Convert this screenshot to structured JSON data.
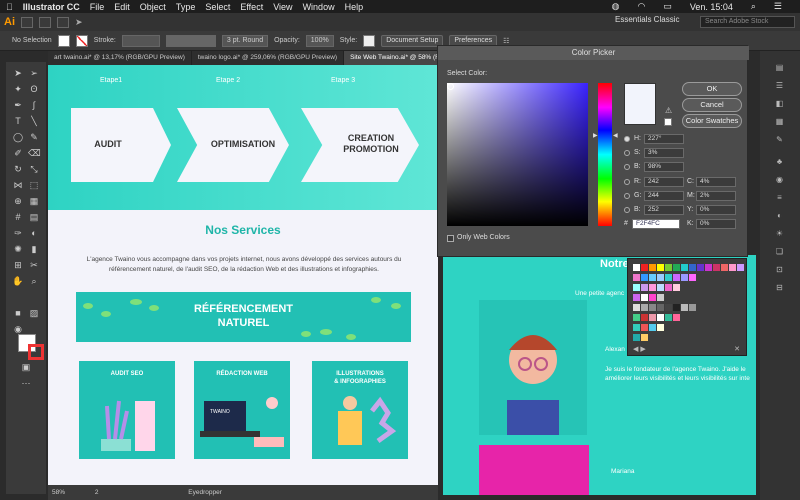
{
  "menubar": {
    "apple": "",
    "app": "Illustrator CC",
    "items": [
      "File",
      "Edit",
      "Object",
      "Type",
      "Select",
      "Effect",
      "View",
      "Window",
      "Help"
    ],
    "clock": "Ven. 15:04"
  },
  "appbar": {
    "logo": "Ai",
    "workspace": "Essentials Classic",
    "search_placeholder": "Search Adobe Stock"
  },
  "control_bar": {
    "selection": "No Selection",
    "stroke_label": "Stroke:",
    "brush": "3 pt. Round",
    "opacity_label": "Opacity:",
    "opacity_value": "100%",
    "style_label": "Style:",
    "doc_setup": "Document Setup",
    "preferences": "Preferences"
  },
  "tabs": [
    {
      "label": "art twaino.ai* @ 13,17% (RGB/GPU Preview)",
      "active": false
    },
    {
      "label": "twaino logo.ai* @ 259,06% (RGB/GPU Preview)",
      "active": false
    },
    {
      "label": "Site Web Twaino.ai* @ 58% (RGB/GPU Preview)",
      "active": true
    }
  ],
  "artboard": {
    "steps": [
      "Etape1",
      "Etape 2",
      "Etape 3"
    ],
    "chevrons": [
      "AUDIT",
      "OPTIMISATION",
      "CREATION\nPROMOTION"
    ],
    "services_title": "Nos Services",
    "services_text": "L'agence Twaino vous accompagne dans vos projets internet, nous avons développé des services autours du référencement naturel, de l'audit SEO, de la rédaction Web et des illustrations et infographies.",
    "banner": "RÉFÉRENCEMENT\nNATUREL",
    "cards": [
      "AUDIT SEO",
      "RÉDACTION WEB",
      "ILLUSTRATIONS\n& INFOGRAPHIES"
    ],
    "laptop_text": "TWAINO"
  },
  "right_artboard": {
    "title": "Notre",
    "tagline": "Une petite agenc",
    "name1": "Alexan",
    "bio": "Je suis le fondateur de l'agence Twaino. J'aide le\naméliorer leurs visibilités et leurs visibilités sur inte",
    "name2": "Mariana"
  },
  "color_picker": {
    "title": "Color Picker",
    "select_label": "Select Color:",
    "ok": "OK",
    "cancel": "Cancel",
    "swatches": "Color Swatches",
    "H": "227°",
    "S": "3%",
    "B": "98%",
    "R": "242",
    "G": "244",
    "Bv": "252",
    "C": "4%",
    "M": "2%",
    "Y": "0%",
    "K": "0%",
    "hex": "F2F4FC",
    "only_web": "Only Web Colors",
    "colors": {
      "preview": "#f2f4fc",
      "hue": "#3a23ff"
    }
  },
  "status": {
    "zoom": "58%",
    "page": "2",
    "tool": "Eyedropper"
  },
  "colors": {
    "teal": "#2ed3c3",
    "teal_dark": "#1fb5a8",
    "magenta": "#e724a9",
    "chevron_bg": "#f4f5fb"
  }
}
